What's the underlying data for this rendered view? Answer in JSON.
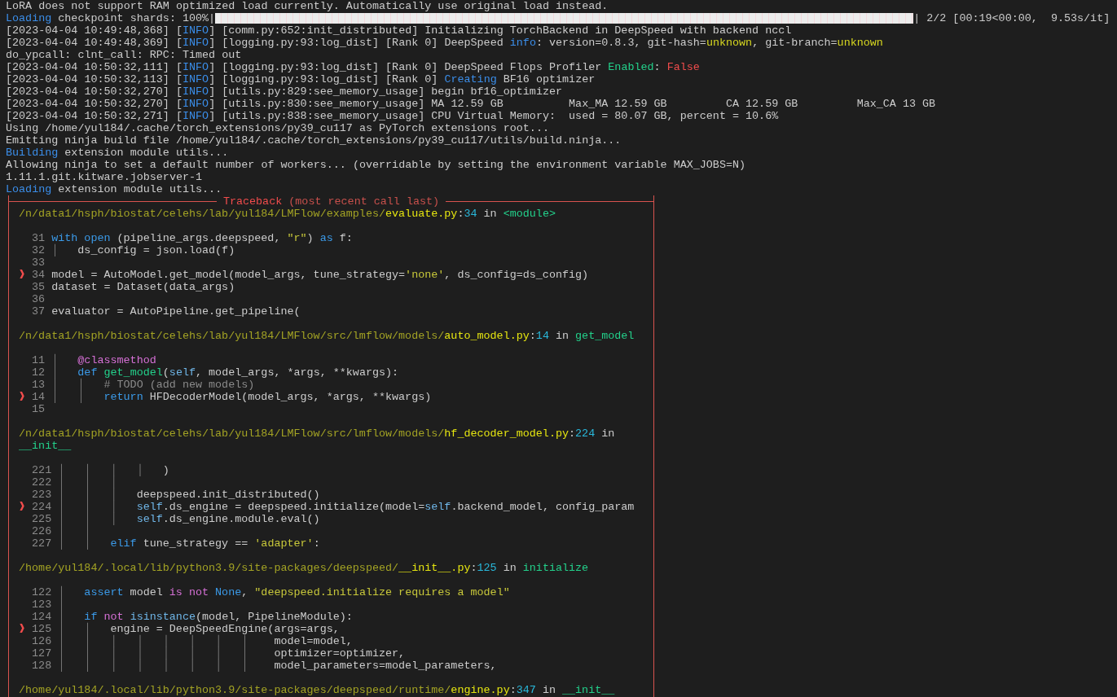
{
  "log_lines": [
    {
      "kind": "text",
      "segments": [
        {
          "text": "LoRA does not support RAM optimized load currently. Automatically use original load instead.",
          "kind": "plain"
        }
      ]
    },
    {
      "kind": "progress",
      "segments": [
        {
          "text": "Loading",
          "kind": "blue"
        },
        {
          "text": " checkpoint shards: 100%|",
          "kind": "plain"
        }
      ],
      "progress": {
        "level": 1
      },
      "after": [
        {
          "text": "| 2/2 [00:19<00:00,  9.53s/it]",
          "kind": "plain"
        }
      ]
    },
    {
      "kind": "text",
      "segments": [
        {
          "text": "[2023-04-04 10:49:48,368] [",
          "kind": "plain"
        },
        {
          "text": "INFO",
          "kind": "blue"
        },
        {
          "text": "] [comm.py:652:init_distributed] Initializing TorchBackend in DeepSpeed with backend nccl",
          "kind": "plain"
        }
      ]
    },
    {
      "kind": "text",
      "segments": [
        {
          "text": "[2023-04-04 10:49:48,369] [",
          "kind": "plain"
        },
        {
          "text": "INFO",
          "kind": "blue"
        },
        {
          "text": "] [logging.py:93:log_dist] [Rank 0] DeepSpeed ",
          "kind": "plain"
        },
        {
          "text": "info",
          "kind": "blue"
        },
        {
          "text": ": version=0.8.3, git-hash=",
          "kind": "plain"
        },
        {
          "text": "unknown",
          "kind": "yellow"
        },
        {
          "text": ", git-branch=",
          "kind": "plain"
        },
        {
          "text": "unknown",
          "kind": "yellow"
        }
      ]
    },
    {
      "kind": "text",
      "segments": [
        {
          "text": "do_ypcall: clnt_call: RPC: Timed out",
          "kind": "plain"
        }
      ]
    },
    {
      "kind": "text",
      "segments": [
        {
          "text": "[2023-04-04 10:50:32,111] [",
          "kind": "plain"
        },
        {
          "text": "INFO",
          "kind": "blue"
        },
        {
          "text": "] [logging.py:93:log_dist] [Rank 0] DeepSpeed Flops Profiler ",
          "kind": "plain"
        },
        {
          "text": "Enabled",
          "kind": "green"
        },
        {
          "text": ": ",
          "kind": "plain"
        },
        {
          "text": "False",
          "kind": "red"
        }
      ]
    },
    {
      "kind": "text",
      "segments": [
        {
          "text": "[2023-04-04 10:50:32,113] [",
          "kind": "plain"
        },
        {
          "text": "INFO",
          "kind": "blue"
        },
        {
          "text": "] [logging.py:93:log_dist] [Rank 0] ",
          "kind": "plain"
        },
        {
          "text": "Creating",
          "kind": "blue"
        },
        {
          "text": " BF16 optimizer",
          "kind": "plain"
        }
      ]
    },
    {
      "kind": "text",
      "segments": [
        {
          "text": "[2023-04-04 10:50:32,270] [",
          "kind": "plain"
        },
        {
          "text": "INFO",
          "kind": "blue"
        },
        {
          "text": "] [utils.py:829:see_memory_usage] begin bf16_optimizer",
          "kind": "plain"
        }
      ]
    },
    {
      "kind": "text",
      "segments": [
        {
          "text": "[2023-04-04 10:50:32,270] [",
          "kind": "plain"
        },
        {
          "text": "INFO",
          "kind": "blue"
        },
        {
          "text": "] [utils.py:830:see_memory_usage] MA 12.59 GB          Max_MA 12.59 GB         CA 12.59 GB         Max_CA 13 GB",
          "kind": "plain"
        }
      ]
    },
    {
      "kind": "text",
      "segments": [
        {
          "text": "[2023-04-04 10:50:32,271] [",
          "kind": "plain"
        },
        {
          "text": "INFO",
          "kind": "blue"
        },
        {
          "text": "] [utils.py:838:see_memory_usage] CPU Virtual Memory:  used = 80.07 GB, percent = 10.6%",
          "kind": "plain"
        }
      ]
    },
    {
      "kind": "text",
      "segments": [
        {
          "text": "Using /home/yul184/.cache/torch_extensions/py39_cu117 as PyTorch extensions root...",
          "kind": "plain"
        }
      ]
    },
    {
      "kind": "text",
      "segments": [
        {
          "text": "Emitting ninja build file /home/yul184/.cache/torch_extensions/py39_cu117/utils/build.ninja...",
          "kind": "plain"
        }
      ]
    },
    {
      "kind": "text",
      "segments": [
        {
          "text": "Building",
          "kind": "blue"
        },
        {
          "text": " extension module utils...",
          "kind": "plain"
        }
      ]
    },
    {
      "kind": "text",
      "segments": [
        {
          "text": "Allowing ninja to set a default number of workers... (overridable by setting the environment variable MAX_JOBS=N)",
          "kind": "plain"
        }
      ]
    },
    {
      "kind": "text",
      "segments": [
        {
          "text": "1.11.1.git.kitware.jobserver-1",
          "kind": "plain"
        }
      ]
    },
    {
      "kind": "text",
      "segments": [
        {
          "text": "Loading",
          "kind": "blue"
        },
        {
          "text": " extension module utils...",
          "kind": "plain"
        }
      ]
    }
  ],
  "traceback": {
    "title": [
      {
        "text": "Traceback",
        "kind": "red"
      },
      {
        "text": " (most recent call last)",
        "kind": "dimred"
      }
    ],
    "current_marker": "❱",
    "frames": [
      {
        "location_lines": [
          [
            {
              "text": "/n/data1/hsph/biostat/celehs/lab/yul184/LMFlow/examples/",
              "kind": "path"
            },
            {
              "text": "evaluate.py",
              "kind": "file"
            },
            {
              "text": ":",
              "kind": "plain"
            },
            {
              "text": "34",
              "kind": "num"
            },
            {
              "text": " in ",
              "kind": "plain"
            },
            {
              "text": "<module>",
              "kind": "green"
            }
          ]
        ],
        "lines": [
          {
            "number": "31",
            "current": false,
            "segments": [
              {
                "text": "with ",
                "kind": "kw"
              },
              {
                "text": "open",
                "kind": "kw"
              },
              {
                "text": " (pipeline_args.deepspeed, ",
                "kind": "plain"
              },
              {
                "text": "\"r\"",
                "kind": "str"
              },
              {
                "text": ") ",
                "kind": "plain"
              },
              {
                "text": "as",
                "kind": "kw"
              },
              {
                "text": " f:",
                "kind": "plain"
              }
            ]
          },
          {
            "number": "32",
            "current": false,
            "segments": [
              {
                "text": "│   ",
                "kind": "guide"
              },
              {
                "text": "ds_config = json.load(f)",
                "kind": "plain"
              }
            ]
          },
          {
            "number": "33",
            "current": false
          },
          {
            "number": "34",
            "current": true,
            "segments": [
              {
                "text": "model = AutoModel.get_model(model_args, tune_strategy=",
                "kind": "plain"
              },
              {
                "text": "'none'",
                "kind": "str"
              },
              {
                "text": ", ds_config=ds_config)",
                "kind": "plain"
              }
            ]
          },
          {
            "number": "35",
            "current": false,
            "segments": [
              {
                "text": "dataset = Dataset(data_args)",
                "kind": "plain"
              }
            ]
          },
          {
            "number": "36",
            "current": false
          },
          {
            "number": "37",
            "current": false,
            "segments": [
              {
                "text": "evaluator = AutoPipeline.get_pipeline(",
                "kind": "plain"
              }
            ]
          }
        ]
      },
      {
        "location_lines": [
          [
            {
              "text": "/n/data1/hsph/biostat/celehs/lab/yul184/LMFlow/src/lmflow/models/",
              "kind": "path"
            },
            {
              "text": "auto_model.py",
              "kind": "file"
            },
            {
              "text": ":",
              "kind": "plain"
            },
            {
              "text": "14",
              "kind": "num"
            },
            {
              "text": " in ",
              "kind": "plain"
            },
            {
              "text": "get_model",
              "kind": "green"
            }
          ]
        ],
        "lines": [
          {
            "number": "11",
            "current": false,
            "segments": [
              {
                "text": "│   ",
                "kind": "guide"
              },
              {
                "text": "@classmethod",
                "kind": "magenta"
              }
            ]
          },
          {
            "number": "12",
            "current": false,
            "segments": [
              {
                "text": "│   ",
                "kind": "guide"
              },
              {
                "text": "def ",
                "kind": "kw"
              },
              {
                "text": "get_model",
                "kind": "green"
              },
              {
                "text": "(",
                "kind": "plain"
              },
              {
                "text": "self",
                "kind": "self"
              },
              {
                "text": ", model_args, *args, **kwargs):",
                "kind": "plain"
              }
            ]
          },
          {
            "number": "13",
            "current": false,
            "segments": [
              {
                "text": "│   │   ",
                "kind": "guide"
              },
              {
                "text": "# TODO (add new models)",
                "kind": "comment"
              }
            ]
          },
          {
            "number": "14",
            "current": true,
            "segments": [
              {
                "text": "│   │   ",
                "kind": "guide"
              },
              {
                "text": "return",
                "kind": "kw"
              },
              {
                "text": " HFDecoderModel(model_args, *args, **kwargs)",
                "kind": "plain"
              }
            ]
          },
          {
            "number": "15",
            "current": false
          }
        ]
      },
      {
        "location_lines": [
          [
            {
              "text": "/n/data1/hsph/biostat/celehs/lab/yul184/LMFlow/src/lmflow/models/",
              "kind": "path"
            },
            {
              "text": "hf_decoder_model.py",
              "kind": "file"
            },
            {
              "text": ":",
              "kind": "plain"
            },
            {
              "text": "224",
              "kind": "num"
            },
            {
              "text": " in",
              "kind": "plain"
            }
          ],
          [
            {
              "text": "__init__",
              "kind": "green"
            }
          ]
        ],
        "lines": [
          {
            "number": "221",
            "current": false,
            "segments": [
              {
                "text": "│   │   │   │   ",
                "kind": "guide"
              },
              {
                "text": ")",
                "kind": "plain"
              }
            ]
          },
          {
            "number": "222",
            "current": false,
            "segments": [
              {
                "text": "│   │   │",
                "kind": "guide"
              }
            ]
          },
          {
            "number": "223",
            "current": false,
            "segments": [
              {
                "text": "│   │   │   ",
                "kind": "guide"
              },
              {
                "text": "deepspeed.init_distributed()",
                "kind": "plain"
              }
            ]
          },
          {
            "number": "224",
            "current": true,
            "segments": [
              {
                "text": "│   │   │   ",
                "kind": "guide"
              },
              {
                "text": "self",
                "kind": "self"
              },
              {
                "text": ".ds_engine = deepspeed.initialize(model=",
                "kind": "plain"
              },
              {
                "text": "self",
                "kind": "self"
              },
              {
                "text": ".backend_model, config_param",
                "kind": "plain"
              }
            ]
          },
          {
            "number": "225",
            "current": false,
            "segments": [
              {
                "text": "│   │   │   ",
                "kind": "guide"
              },
              {
                "text": "self",
                "kind": "self"
              },
              {
                "text": ".ds_engine.module.eval()",
                "kind": "plain"
              }
            ]
          },
          {
            "number": "226",
            "current": false,
            "segments": [
              {
                "text": "│   │",
                "kind": "guide"
              }
            ]
          },
          {
            "number": "227",
            "current": false,
            "segments": [
              {
                "text": "│   │   ",
                "kind": "guide"
              },
              {
                "text": "elif",
                "kind": "kw"
              },
              {
                "text": " tune_strategy == ",
                "kind": "plain"
              },
              {
                "text": "'adapter'",
                "kind": "str"
              },
              {
                "text": ":",
                "kind": "plain"
              }
            ]
          }
        ]
      },
      {
        "location_lines": [
          [
            {
              "text": "/home/yul184/.local/lib/python3.9/site-packages/deepspeed/",
              "kind": "path"
            },
            {
              "text": "__init__.py",
              "kind": "file"
            },
            {
              "text": ":",
              "kind": "plain"
            },
            {
              "text": "125",
              "kind": "num"
            },
            {
              "text": " in ",
              "kind": "plain"
            },
            {
              "text": "initialize",
              "kind": "green"
            }
          ]
        ],
        "lines": [
          {
            "number": "122",
            "current": false,
            "segments": [
              {
                "text": "│   ",
                "kind": "guide"
              },
              {
                "text": "assert",
                "kind": "kw"
              },
              {
                "text": " model ",
                "kind": "plain"
              },
              {
                "text": "is not ",
                "kind": "magenta"
              },
              {
                "text": "None",
                "kind": "kw"
              },
              {
                "text": ", ",
                "kind": "plain"
              },
              {
                "text": "\"deepspeed.initialize requires a model\"",
                "kind": "str"
              }
            ]
          },
          {
            "number": "123",
            "current": false,
            "segments": [
              {
                "text": "│",
                "kind": "guide"
              }
            ]
          },
          {
            "number": "124",
            "current": false,
            "segments": [
              {
                "text": "│   ",
                "kind": "guide"
              },
              {
                "text": "if ",
                "kind": "kw"
              },
              {
                "text": "not ",
                "kind": "magenta"
              },
              {
                "text": "isinstance",
                "kind": "self"
              },
              {
                "text": "(model, PipelineModule):",
                "kind": "plain"
              }
            ]
          },
          {
            "number": "125",
            "current": true,
            "segments": [
              {
                "text": "│   │   ",
                "kind": "guide"
              },
              {
                "text": "engine = DeepSpeedEngine(args=args,",
                "kind": "plain"
              }
            ]
          },
          {
            "number": "126",
            "current": false,
            "segments": [
              {
                "text": "│   │   │   │   │   │   │   │    ",
                "kind": "guide"
              },
              {
                "text": "model=model,",
                "kind": "plain"
              }
            ]
          },
          {
            "number": "127",
            "current": false,
            "segments": [
              {
                "text": "│   │   │   │   │   │   │   │    ",
                "kind": "guide"
              },
              {
                "text": "optimizer=optimizer,",
                "kind": "plain"
              }
            ]
          },
          {
            "number": "128",
            "current": false,
            "segments": [
              {
                "text": "│   │   │   │   │   │   │   │    ",
                "kind": "guide"
              },
              {
                "text": "model_parameters=model_parameters,",
                "kind": "plain"
              }
            ]
          }
        ]
      },
      {
        "location_lines": [
          [
            {
              "text": "/home/yul184/.local/lib/python3.9/site-packages/deepspeed/runtime/",
              "kind": "path"
            },
            {
              "text": "engine.py",
              "kind": "file"
            },
            {
              "text": ":",
              "kind": "plain"
            },
            {
              "text": "347",
              "kind": "num"
            },
            {
              "text": " in ",
              "kind": "plain"
            },
            {
              "text": "__init__",
              "kind": "green"
            }
          ]
        ]
      }
    ]
  }
}
